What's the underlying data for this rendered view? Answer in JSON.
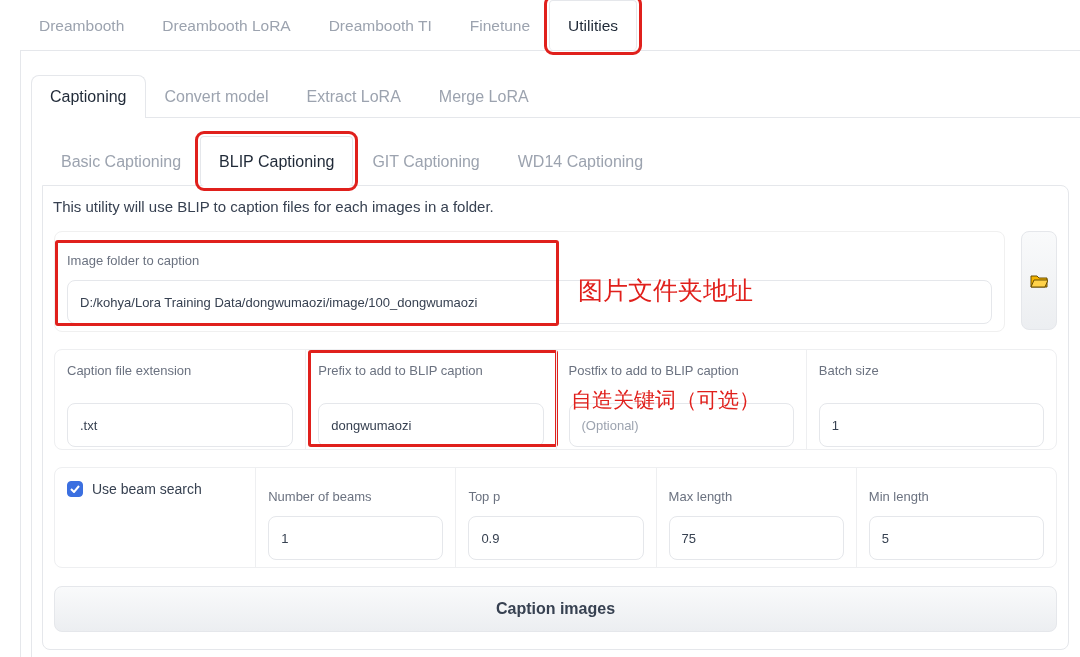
{
  "top_tabs": [
    {
      "label": "Dreambooth",
      "selected": false,
      "highlighted": false
    },
    {
      "label": "Dreambooth LoRA",
      "selected": false,
      "highlighted": false
    },
    {
      "label": "Dreambooth TI",
      "selected": false,
      "highlighted": false
    },
    {
      "label": "Finetune",
      "selected": false,
      "highlighted": false
    },
    {
      "label": "Utilities",
      "selected": true,
      "highlighted": true
    }
  ],
  "utility_tabs": [
    {
      "label": "Captioning",
      "selected": true,
      "highlighted": false
    },
    {
      "label": "Convert model",
      "selected": false,
      "highlighted": false
    },
    {
      "label": "Extract LoRA",
      "selected": false,
      "highlighted": false
    },
    {
      "label": "Merge LoRA",
      "selected": false,
      "highlighted": false
    }
  ],
  "captioning_tabs": [
    {
      "label": "Basic Captioning",
      "selected": false,
      "highlighted": false
    },
    {
      "label": "BLIP Captioning",
      "selected": true,
      "highlighted": true
    },
    {
      "label": "GIT Captioning",
      "selected": false,
      "highlighted": false
    },
    {
      "label": "WD14 Captioning",
      "selected": false,
      "highlighted": false
    }
  ],
  "description": "This utility will use BLIP to caption files for each images in a folder.",
  "image_folder": {
    "label": "Image folder to caption",
    "value": "D:/kohya/Lora Training Data/dongwumaozi/image/100_dongwumaozi",
    "highlighted": true
  },
  "caption_fields": [
    {
      "label": "Caption file extension",
      "value": ".txt",
      "highlighted": false
    },
    {
      "label": "Prefix to add to BLIP caption",
      "value": "dongwumaozi",
      "highlighted": true
    },
    {
      "label": "Postfix to add to BLIP caption",
      "placeholder": "(Optional)",
      "highlighted": false
    },
    {
      "label": "Batch size",
      "value": "1",
      "highlighted": false
    }
  ],
  "beam_search": {
    "label": "Use beam search",
    "checked": true
  },
  "beam_fields": [
    {
      "label": "Number of beams",
      "value": "1"
    },
    {
      "label": "Top p",
      "value": "0.9"
    },
    {
      "label": "Max length",
      "value": "75"
    },
    {
      "label": "Min length",
      "value": "5"
    }
  ],
  "caption_button": "Caption images",
  "annotations": [
    {
      "text": "图片文件夹地址"
    },
    {
      "text": "自造关键词（可选）"
    }
  ]
}
